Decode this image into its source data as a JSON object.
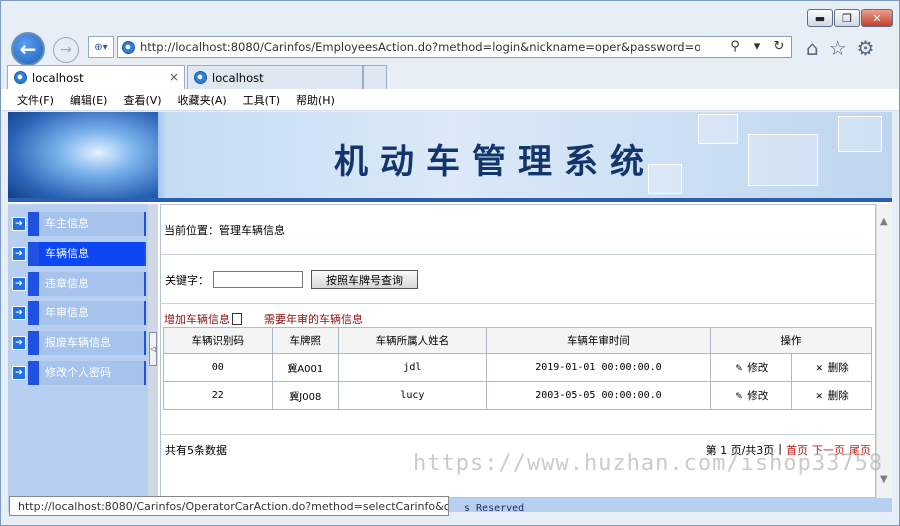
{
  "window": {
    "minimize_glyph": "▬",
    "maximize_glyph": "❐",
    "close_glyph": "✕"
  },
  "nav": {
    "back_glyph": "←",
    "forward_glyph": "→",
    "compat_glyph": "⊕▾",
    "address_url": "http://localhost:8080/Carinfos/EmployeesAction.do?method=login&nickname=oper&password=oper&pop",
    "search_glyph": "⚲",
    "dropdown_glyph": "▾",
    "refresh_glyph": "↻",
    "home_glyph": "⌂",
    "favorites_glyph": "☆",
    "settings_glyph": "⚙"
  },
  "tabs": [
    {
      "label": "localhost",
      "close": "×"
    },
    {
      "label": "localhost"
    }
  ],
  "menu": [
    "文件(F)",
    "编辑(E)",
    "查看(V)",
    "收藏夹(A)",
    "工具(T)",
    "帮助(H)"
  ],
  "banner": {
    "title": "机动车管理系统"
  },
  "sidebar": {
    "items": [
      {
        "label": "车主信息",
        "active": false
      },
      {
        "label": "车辆信息",
        "active": true
      },
      {
        "label": "违章信息",
        "active": false
      },
      {
        "label": "年审信息",
        "active": false
      },
      {
        "label": "报废车辆信息",
        "active": false
      },
      {
        "label": "修改个人密码",
        "active": false
      }
    ],
    "arrow_glyph": "➔"
  },
  "splitter": {
    "handle_glyph": "◁"
  },
  "main": {
    "location": "当前位置：管理车辆信息",
    "search": {
      "label": "关键字：",
      "value": "",
      "button": "按照车牌号查询"
    },
    "actions": {
      "add": "增加车辆信息",
      "annual": "需要年审的车辆信息"
    },
    "table": {
      "headers": [
        "车辆识别码",
        "车牌照",
        "车辆所属人姓名",
        "车辆年审时间",
        "操作"
      ],
      "rows": [
        {
          "id": "00",
          "plate": "冀A001",
          "owner": "jdl",
          "date": "2019-01-01 00:00:00.0",
          "edit": "修改",
          "delete": "删除"
        },
        {
          "id": "22",
          "plate": "冀J008",
          "owner": "lucy",
          "date": "2003-05-05 00:00:00.0",
          "edit": "修改",
          "delete": "删除"
        }
      ]
    },
    "footer": {
      "total": "共有5条数据",
      "page_info": "第 1 页/共3页",
      "separator": "|",
      "first": "首页",
      "next": "下一页",
      "last": "尾页"
    }
  },
  "scroll": {
    "up_glyph": "▲",
    "down_glyph": "▼"
  },
  "copyright_fragment": "s Reserved",
  "status_url": "http://localhost:8080/Carinfos/OperatorCarAction.do?method=selectCarinfo&ope...",
  "watermark": "https://www.huzhan.com/ishop33758"
}
